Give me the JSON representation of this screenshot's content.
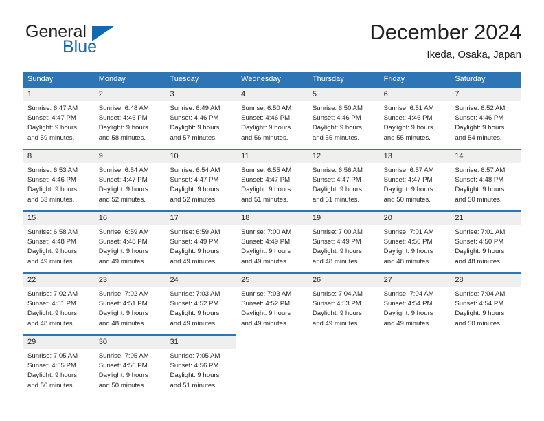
{
  "brand": {
    "word1": "General",
    "word2": "Blue",
    "mark": "triangle-flag-icon",
    "accent_color": "#1269b0"
  },
  "header": {
    "title": "December 2024",
    "subtitle": "Ikeda, Osaka, Japan"
  },
  "theme": {
    "header_row_bg": "#2e75b6",
    "day_band_bg": "#efefef",
    "cell_top_border": "#2e75b6",
    "text_color": "#231f20"
  },
  "calendar": {
    "weekday_headers": [
      "Sunday",
      "Monday",
      "Tuesday",
      "Wednesday",
      "Thursday",
      "Friday",
      "Saturday"
    ],
    "weeks": [
      [
        {
          "day": "1",
          "lines": [
            "Sunrise: 6:47 AM",
            "Sunset: 4:47 PM",
            "Daylight: 9 hours",
            "and 59 minutes."
          ]
        },
        {
          "day": "2",
          "lines": [
            "Sunrise: 6:48 AM",
            "Sunset: 4:46 PM",
            "Daylight: 9 hours",
            "and 58 minutes."
          ]
        },
        {
          "day": "3",
          "lines": [
            "Sunrise: 6:49 AM",
            "Sunset: 4:46 PM",
            "Daylight: 9 hours",
            "and 57 minutes."
          ]
        },
        {
          "day": "4",
          "lines": [
            "Sunrise: 6:50 AM",
            "Sunset: 4:46 PM",
            "Daylight: 9 hours",
            "and 56 minutes."
          ]
        },
        {
          "day": "5",
          "lines": [
            "Sunrise: 6:50 AM",
            "Sunset: 4:46 PM",
            "Daylight: 9 hours",
            "and 55 minutes."
          ]
        },
        {
          "day": "6",
          "lines": [
            "Sunrise: 6:51 AM",
            "Sunset: 4:46 PM",
            "Daylight: 9 hours",
            "and 55 minutes."
          ]
        },
        {
          "day": "7",
          "lines": [
            "Sunrise: 6:52 AM",
            "Sunset: 4:46 PM",
            "Daylight: 9 hours",
            "and 54 minutes."
          ]
        }
      ],
      [
        {
          "day": "8",
          "lines": [
            "Sunrise: 6:53 AM",
            "Sunset: 4:46 PM",
            "Daylight: 9 hours",
            "and 53 minutes."
          ]
        },
        {
          "day": "9",
          "lines": [
            "Sunrise: 6:54 AM",
            "Sunset: 4:47 PM",
            "Daylight: 9 hours",
            "and 52 minutes."
          ]
        },
        {
          "day": "10",
          "lines": [
            "Sunrise: 6:54 AM",
            "Sunset: 4:47 PM",
            "Daylight: 9 hours",
            "and 52 minutes."
          ]
        },
        {
          "day": "11",
          "lines": [
            "Sunrise: 6:55 AM",
            "Sunset: 4:47 PM",
            "Daylight: 9 hours",
            "and 51 minutes."
          ]
        },
        {
          "day": "12",
          "lines": [
            "Sunrise: 6:56 AM",
            "Sunset: 4:47 PM",
            "Daylight: 9 hours",
            "and 51 minutes."
          ]
        },
        {
          "day": "13",
          "lines": [
            "Sunrise: 6:57 AM",
            "Sunset: 4:47 PM",
            "Daylight: 9 hours",
            "and 50 minutes."
          ]
        },
        {
          "day": "14",
          "lines": [
            "Sunrise: 6:57 AM",
            "Sunset: 4:48 PM",
            "Daylight: 9 hours",
            "and 50 minutes."
          ]
        }
      ],
      [
        {
          "day": "15",
          "lines": [
            "Sunrise: 6:58 AM",
            "Sunset: 4:48 PM",
            "Daylight: 9 hours",
            "and 49 minutes."
          ]
        },
        {
          "day": "16",
          "lines": [
            "Sunrise: 6:59 AM",
            "Sunset: 4:48 PM",
            "Daylight: 9 hours",
            "and 49 minutes."
          ]
        },
        {
          "day": "17",
          "lines": [
            "Sunrise: 6:59 AM",
            "Sunset: 4:49 PM",
            "Daylight: 9 hours",
            "and 49 minutes."
          ]
        },
        {
          "day": "18",
          "lines": [
            "Sunrise: 7:00 AM",
            "Sunset: 4:49 PM",
            "Daylight: 9 hours",
            "and 49 minutes."
          ]
        },
        {
          "day": "19",
          "lines": [
            "Sunrise: 7:00 AM",
            "Sunset: 4:49 PM",
            "Daylight: 9 hours",
            "and 48 minutes."
          ]
        },
        {
          "day": "20",
          "lines": [
            "Sunrise: 7:01 AM",
            "Sunset: 4:50 PM",
            "Daylight: 9 hours",
            "and 48 minutes."
          ]
        },
        {
          "day": "21",
          "lines": [
            "Sunrise: 7:01 AM",
            "Sunset: 4:50 PM",
            "Daylight: 9 hours",
            "and 48 minutes."
          ]
        }
      ],
      [
        {
          "day": "22",
          "lines": [
            "Sunrise: 7:02 AM",
            "Sunset: 4:51 PM",
            "Daylight: 9 hours",
            "and 48 minutes."
          ]
        },
        {
          "day": "23",
          "lines": [
            "Sunrise: 7:02 AM",
            "Sunset: 4:51 PM",
            "Daylight: 9 hours",
            "and 48 minutes."
          ]
        },
        {
          "day": "24",
          "lines": [
            "Sunrise: 7:03 AM",
            "Sunset: 4:52 PM",
            "Daylight: 9 hours",
            "and 49 minutes."
          ]
        },
        {
          "day": "25",
          "lines": [
            "Sunrise: 7:03 AM",
            "Sunset: 4:52 PM",
            "Daylight: 9 hours",
            "and 49 minutes."
          ]
        },
        {
          "day": "26",
          "lines": [
            "Sunrise: 7:04 AM",
            "Sunset: 4:53 PM",
            "Daylight: 9 hours",
            "and 49 minutes."
          ]
        },
        {
          "day": "27",
          "lines": [
            "Sunrise: 7:04 AM",
            "Sunset: 4:54 PM",
            "Daylight: 9 hours",
            "and 49 minutes."
          ]
        },
        {
          "day": "28",
          "lines": [
            "Sunrise: 7:04 AM",
            "Sunset: 4:54 PM",
            "Daylight: 9 hours",
            "and 50 minutes."
          ]
        }
      ],
      [
        {
          "day": "29",
          "lines": [
            "Sunrise: 7:05 AM",
            "Sunset: 4:55 PM",
            "Daylight: 9 hours",
            "and 50 minutes."
          ]
        },
        {
          "day": "30",
          "lines": [
            "Sunrise: 7:05 AM",
            "Sunset: 4:56 PM",
            "Daylight: 9 hours",
            "and 50 minutes."
          ]
        },
        {
          "day": "31",
          "lines": [
            "Sunrise: 7:05 AM",
            "Sunset: 4:56 PM",
            "Daylight: 9 hours",
            "and 51 minutes."
          ]
        },
        {
          "day": "",
          "lines": []
        },
        {
          "day": "",
          "lines": []
        },
        {
          "day": "",
          "lines": []
        },
        {
          "day": "",
          "lines": []
        }
      ]
    ]
  }
}
